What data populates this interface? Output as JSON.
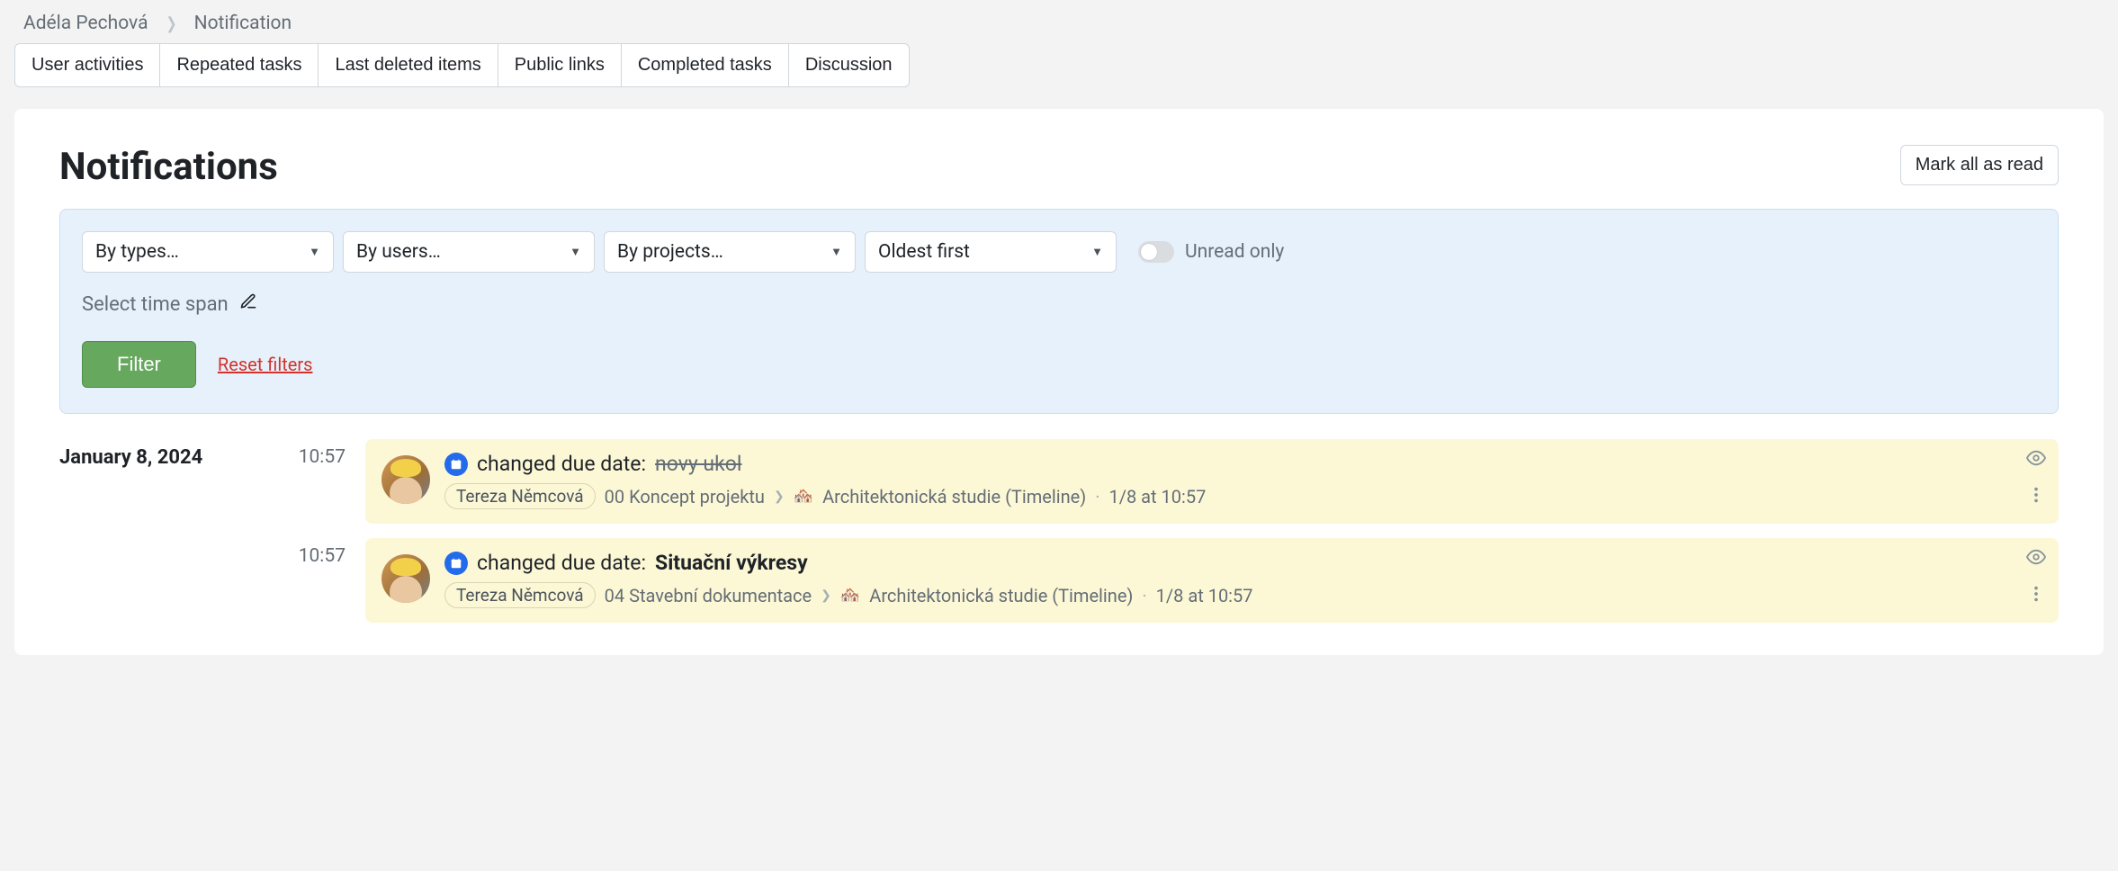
{
  "breadcrumb": {
    "user": "Adéla Pechová",
    "page": "Notification"
  },
  "tabs": [
    "User activities",
    "Repeated tasks",
    "Last deleted items",
    "Public links",
    "Completed tasks",
    "Discussion"
  ],
  "header": {
    "title": "Notifications",
    "mark_all": "Mark all as read"
  },
  "filters": {
    "types": "By types…",
    "users": "By users…",
    "projects": "By projects…",
    "sort": "Oldest first",
    "unread_only": "Unread only",
    "timespan": "Select time span",
    "filter_btn": "Filter",
    "reset": "Reset filters"
  },
  "group_date": "January 8, 2024",
  "notifications": [
    {
      "time": "10:57",
      "action_prefix": "changed due date:",
      "subject": "novy ukol",
      "subject_strike": true,
      "subject_bold": false,
      "user": "Tereza Němcová",
      "project": "00 Koncept projektu",
      "timeline": "Architektonická studie (Timeline)",
      "timestamp": "1/8 at 10:57"
    },
    {
      "time": "10:57",
      "action_prefix": "changed due date:",
      "subject": "Situační výkresy",
      "subject_strike": false,
      "subject_bold": true,
      "user": "Tereza Němcová",
      "project": "04 Stavební dokumentace",
      "timeline": "Architektonická studie (Timeline)",
      "timestamp": "1/8 at 10:57"
    }
  ]
}
